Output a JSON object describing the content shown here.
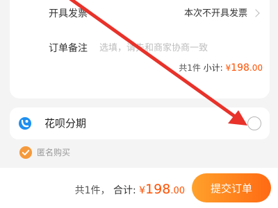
{
  "order": {
    "invoice_label": "开具发票",
    "invoice_value": "本次不开具发票",
    "remark_label": "订单备注",
    "remark_placeholder": "选填，请先和商家协商一致",
    "subtotal_count": "共1件",
    "subtotal_label": "小计:",
    "subtotal_currency": "¥",
    "subtotal_int": "198",
    "subtotal_dec": ".00"
  },
  "payment": {
    "huabei_label": "花呗分期",
    "huabei_icon": "huabei-icon",
    "huabei_selected": false
  },
  "anonymous": {
    "label": "匿名购买",
    "checked": true
  },
  "footer": {
    "count": "共1件，",
    "total_label": "合计:",
    "currency": "¥",
    "total_int": "198",
    "total_dec": ".00",
    "submit_label": "提交订单"
  },
  "colors": {
    "price": "#ff5000",
    "button_start": "#ffa12b",
    "button_end": "#ff6a13",
    "annotation_arrow": "#e8322a",
    "huabei_blue": "#1e8ff0",
    "check_orange": "#f59a3c"
  }
}
